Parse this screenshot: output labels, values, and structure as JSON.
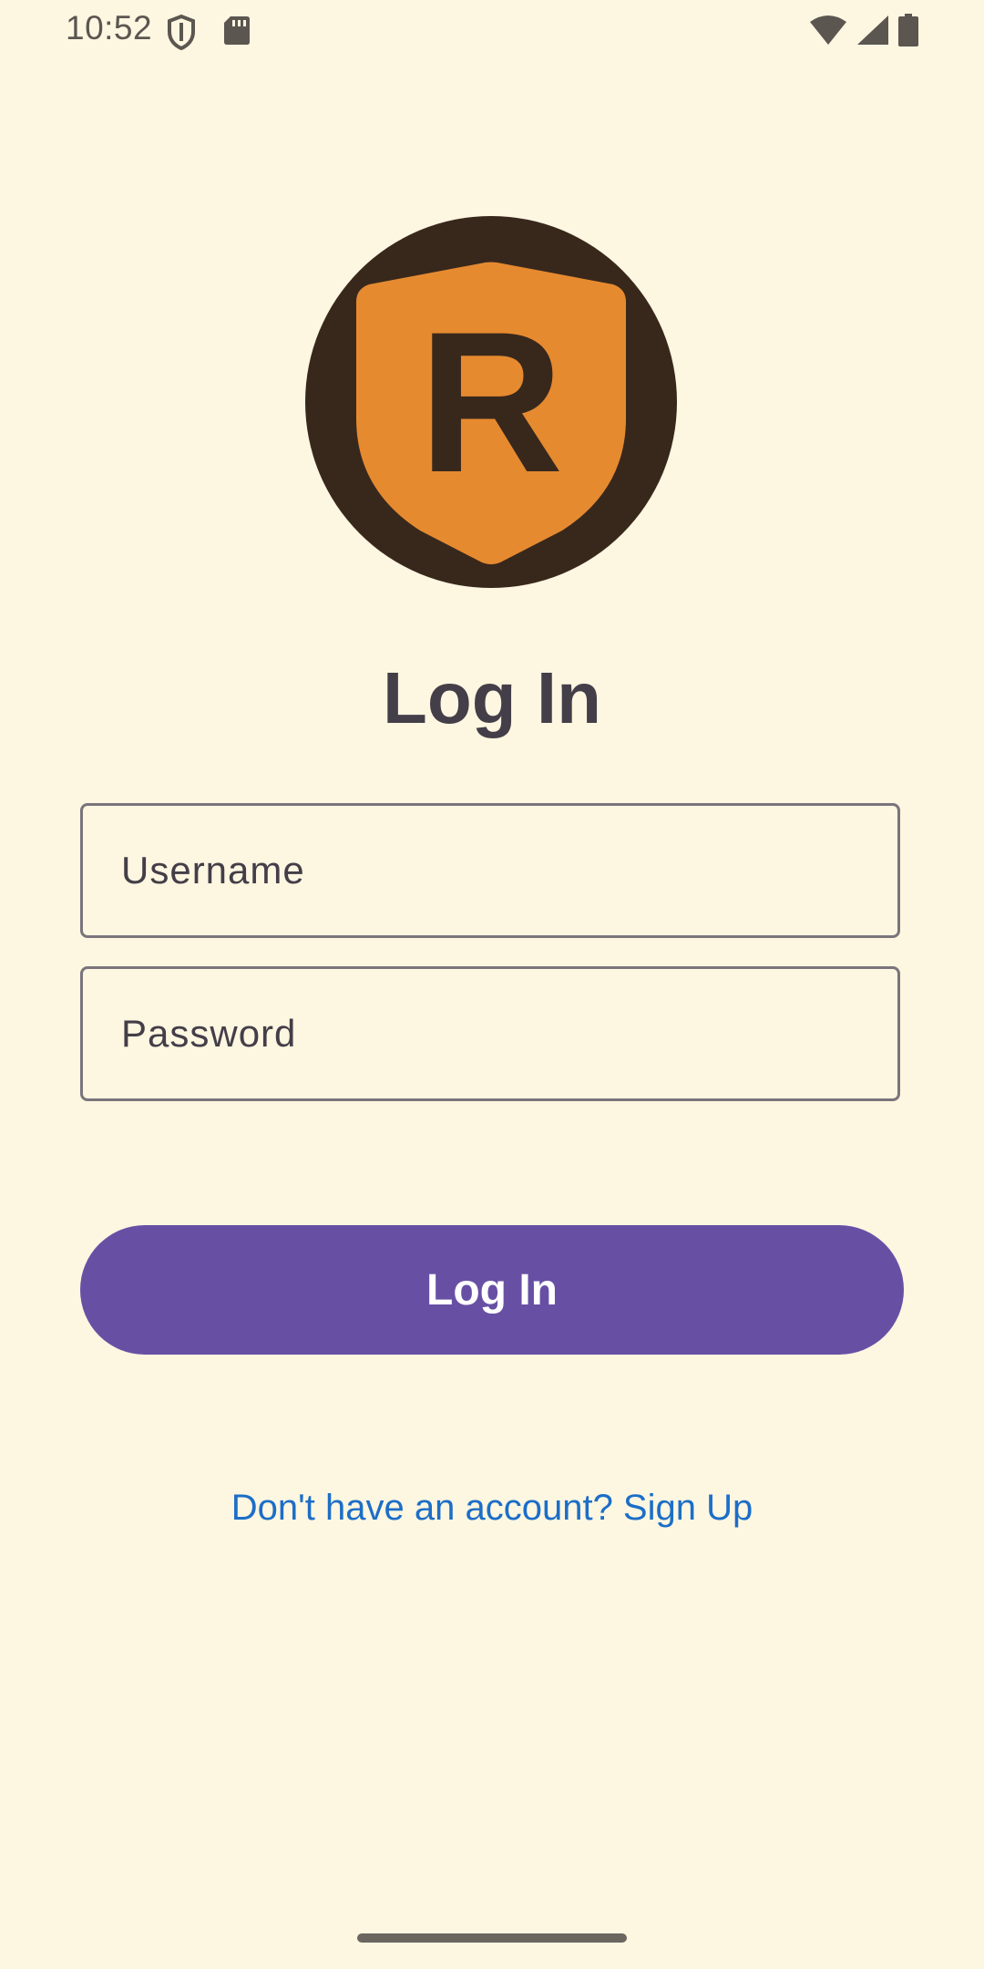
{
  "status_bar": {
    "time": "10:52",
    "icons": [
      "shield-icon",
      "sd-card-icon",
      "wifi-icon",
      "cellular-signal-icon",
      "battery-icon"
    ]
  },
  "logo": {
    "letter": "R",
    "colors": {
      "circle": "#38281C",
      "shield": "#E68A30",
      "letter": "#38281C"
    }
  },
  "login": {
    "title": "Log In",
    "username_placeholder": "Username",
    "password_placeholder": "Password",
    "button_label": "Log In",
    "signup_link": "Don't have an account? Sign Up"
  },
  "colors": {
    "background": "#FDF6E1",
    "primary": "#6750A4",
    "link": "#1C6EC7",
    "text": "#433E48"
  }
}
